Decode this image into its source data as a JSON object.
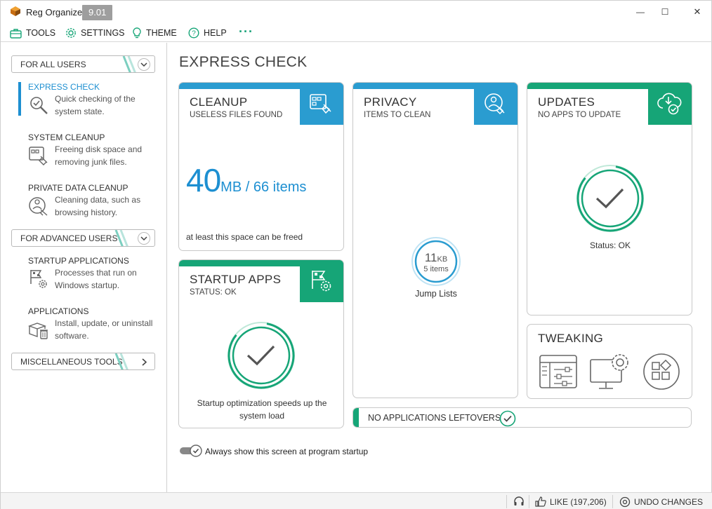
{
  "window": {
    "title": "Reg Organizer",
    "version": "9.01",
    "minimize_icon": "—",
    "maximize_icon": "☐",
    "close_icon": "✕"
  },
  "menu": {
    "tools": "TOOLS",
    "settings": "SETTINGS",
    "theme": "THEME",
    "help": "HELP",
    "more": "···"
  },
  "sidebar": {
    "group_all_users": "FOR ALL USERS",
    "group_advanced": "FOR ADVANCED USERS",
    "group_misc": "MISCELLANEOUS TOOLS",
    "items": [
      {
        "title": "EXPRESS CHECK",
        "desc": "Quick checking of the system state.",
        "icon": "magnifier-check-icon"
      },
      {
        "title": "SYSTEM CLEANUP",
        "desc": "Freeing disk space and removing junk files.",
        "icon": "broom-window-icon"
      },
      {
        "title": "PRIVATE DATA CLEANUP",
        "desc": "Cleaning data, such as browsing history.",
        "icon": "privacy-broom-icon"
      },
      {
        "title": "STARTUP APPLICATIONS",
        "desc": "Processes that run on Windows startup.",
        "icon": "startup-flag-gear-icon"
      },
      {
        "title": "APPLICATIONS",
        "desc": "Install, update, or uninstall software.",
        "icon": "box-trash-icon"
      }
    ]
  },
  "main": {
    "title": "EXPRESS CHECK",
    "cleanup": {
      "title": "CLEANUP",
      "subtitle": "USELESS FILES FOUND",
      "size_value": "40",
      "size_unit": "MB / 66 items",
      "footer": "at least this space can be freed"
    },
    "privacy": {
      "title": "PRIVACY",
      "subtitle": "ITEMS TO CLEAN",
      "ring_value": "11",
      "ring_unit": "KB",
      "ring_items": "5 items",
      "ring_label": "Jump Lists"
    },
    "updates": {
      "title": "UPDATES",
      "subtitle": "NO APPS TO UPDATE",
      "status": "Status: OK"
    },
    "startup": {
      "title": "STARTUP APPS",
      "subtitle": "STATUS: OK",
      "footer": "Startup optimization speeds up the system load"
    },
    "tweaking": {
      "title": "TWEAKING"
    },
    "leftovers": {
      "label": "NO APPLICATIONS LEFTOVERS"
    },
    "startup_toggle_label": "Always show this screen at program startup"
  },
  "statusbar": {
    "like": "LIKE (197,206)",
    "undo": "UNDO CHANGES"
  },
  "colors": {
    "blue": "#2a9cd0",
    "green": "#16a577",
    "accent_text": "#1d8fd1"
  }
}
